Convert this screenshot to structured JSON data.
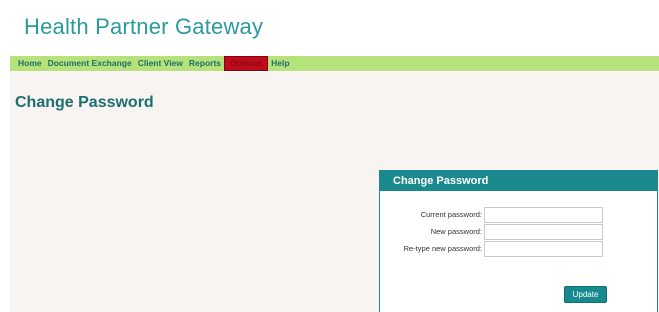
{
  "app": {
    "title": "Health Partner Gateway"
  },
  "nav": {
    "items": [
      "Home",
      "Document Exchange",
      "Client View",
      "Reports",
      "Options",
      "Help"
    ],
    "active": "Options"
  },
  "page": {
    "title": "Change Password"
  },
  "form": {
    "panel_title": "Change Password",
    "current_password_label": "Current password:",
    "new_password_label": "New password:",
    "retype_password_label": "Re-type new password:",
    "current_password_value": "",
    "new_password_value": "",
    "retype_password_value": "",
    "submit_label": "Update"
  },
  "colors": {
    "brand_teal": "#2a9a9f",
    "nav_green": "#b5e27a",
    "active_red": "#c00b1c",
    "panel_teal": "#1b8a8e",
    "content_bg": "#f7f4f1"
  }
}
